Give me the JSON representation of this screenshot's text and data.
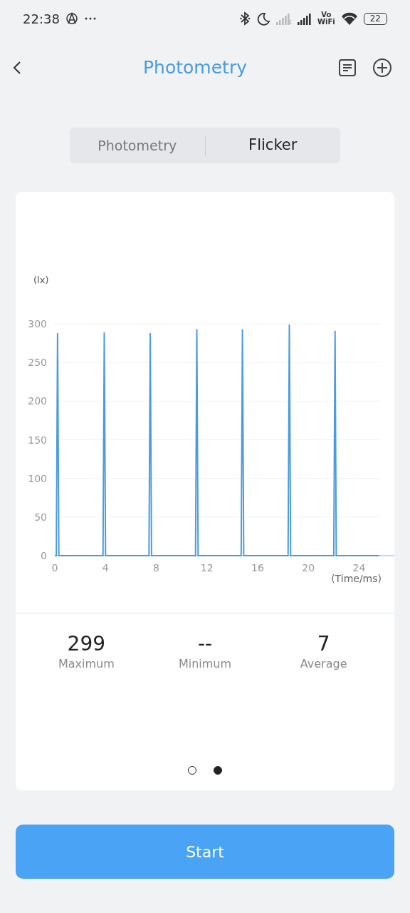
{
  "status_bar": {
    "time": "22:38",
    "vowifi": [
      "Vo",
      "WiFi"
    ],
    "battery": "22"
  },
  "header": {
    "title": "Photometry"
  },
  "tabs": [
    {
      "label": "Photometry",
      "selected": false
    },
    {
      "label": "Flicker",
      "selected": true
    }
  ],
  "chart_data": {
    "type": "line",
    "ylabel": "(lx)",
    "xlabel": "(Time/ms)",
    "xlim": [
      0,
      25.6
    ],
    "ylim": [
      0,
      300
    ],
    "xticks": [
      0,
      4,
      8,
      12,
      16,
      20,
      24
    ],
    "yticks": [
      0,
      50,
      100,
      150,
      200,
      250,
      300
    ],
    "x": [
      0,
      0.12,
      0.22,
      0.32,
      3.8,
      3.9,
      4.0,
      7.43,
      7.53,
      7.63,
      11.1,
      11.2,
      11.3,
      14.7,
      14.8,
      14.9,
      18.4,
      18.5,
      18.6,
      22.0,
      22.1,
      22.2,
      25.6
    ],
    "grid": true,
    "series": [
      {
        "color": "#4a9be0",
        "values": [
          0,
          0,
          288,
          0,
          0,
          289,
          0,
          0,
          288,
          0,
          0,
          293,
          0,
          0,
          293,
          0,
          0,
          299,
          0,
          0,
          291,
          0,
          0
        ]
      }
    ]
  },
  "stats": [
    {
      "value": "299",
      "label": "Maximum"
    },
    {
      "value": "--",
      "label": "Minimum"
    },
    {
      "value": "7",
      "label": "Average"
    }
  ],
  "pages": [
    {
      "selected": false
    },
    {
      "selected": true
    }
  ],
  "start_button": {
    "label": "Start"
  }
}
